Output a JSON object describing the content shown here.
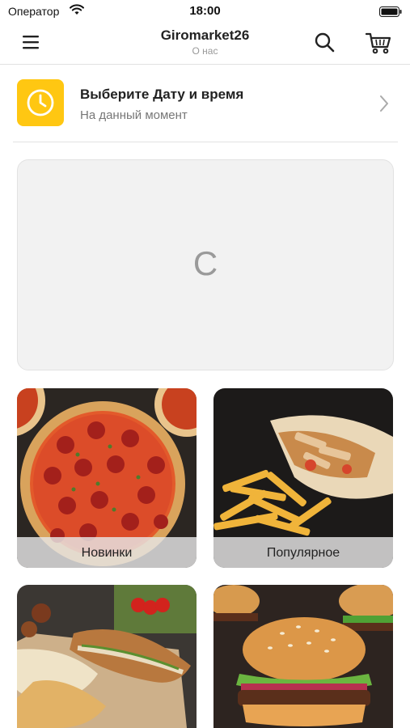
{
  "status_bar": {
    "carrier": "Оператор",
    "time": "18:00"
  },
  "nav": {
    "title": "Giromarket26",
    "subtitle": "О нас"
  },
  "delivery": {
    "title": "Выберите Дату и время",
    "subtitle": "На данный момент"
  },
  "banner": {
    "text": "С"
  },
  "categories": [
    {
      "label": "Новинки",
      "image": "pepperoni-pizza"
    },
    {
      "label": "Популярное",
      "image": "shawarma-with-fries"
    },
    {
      "label": "",
      "image": "grilled-sandwiches"
    },
    {
      "label": "",
      "image": "burgers"
    }
  ],
  "colors": {
    "accent": "#ffc712",
    "text": "#222222",
    "muted": "#999999",
    "banner_bg": "#f2f2f2"
  }
}
